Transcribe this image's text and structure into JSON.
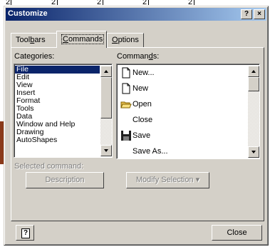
{
  "ruler_marks": [
    "2",
    "2",
    "2",
    "2",
    "2"
  ],
  "dialog": {
    "title": "Customize",
    "help_button_label": "?",
    "close_button_label": "×"
  },
  "tabs": [
    {
      "pre": "Tool",
      "key": "b",
      "post": "ars",
      "active": false
    },
    {
      "pre": "",
      "key": "C",
      "post": "ommands",
      "active": true
    },
    {
      "pre": "",
      "key": "O",
      "post": "ptions",
      "active": false
    }
  ],
  "categories": {
    "label_pre": "Cate",
    "label_key": "g",
    "label_post": "ories:",
    "items": [
      "File",
      "Edit",
      "View",
      "Insert",
      "Format",
      "Tools",
      "Data",
      "Window and Help",
      "Drawing",
      "AutoShapes"
    ],
    "selected": "File"
  },
  "commands": {
    "label_pre": "Comman",
    "label_key": "d",
    "label_post": "s:",
    "items": [
      {
        "label": "New...",
        "icon": "new-document-icon"
      },
      {
        "label": "New",
        "icon": "new-document-icon"
      },
      {
        "label": "Open",
        "icon": "open-folder-icon"
      },
      {
        "label": "Close",
        "icon": ""
      },
      {
        "label": "Save",
        "icon": "save-disk-icon"
      },
      {
        "label": "Save As...",
        "icon": ""
      }
    ]
  },
  "selected_command": {
    "label": "Selected command:",
    "description_button": "Description",
    "modify_selection_button": "Modify Selection ▾"
  },
  "footer": {
    "help_icon_label": "?",
    "close_button": "Close"
  },
  "colors": {
    "face": "#d4d0c8",
    "titlebar_start": "#0a246a",
    "titlebar_end": "#a6caf0",
    "selection": "#0a246a"
  }
}
